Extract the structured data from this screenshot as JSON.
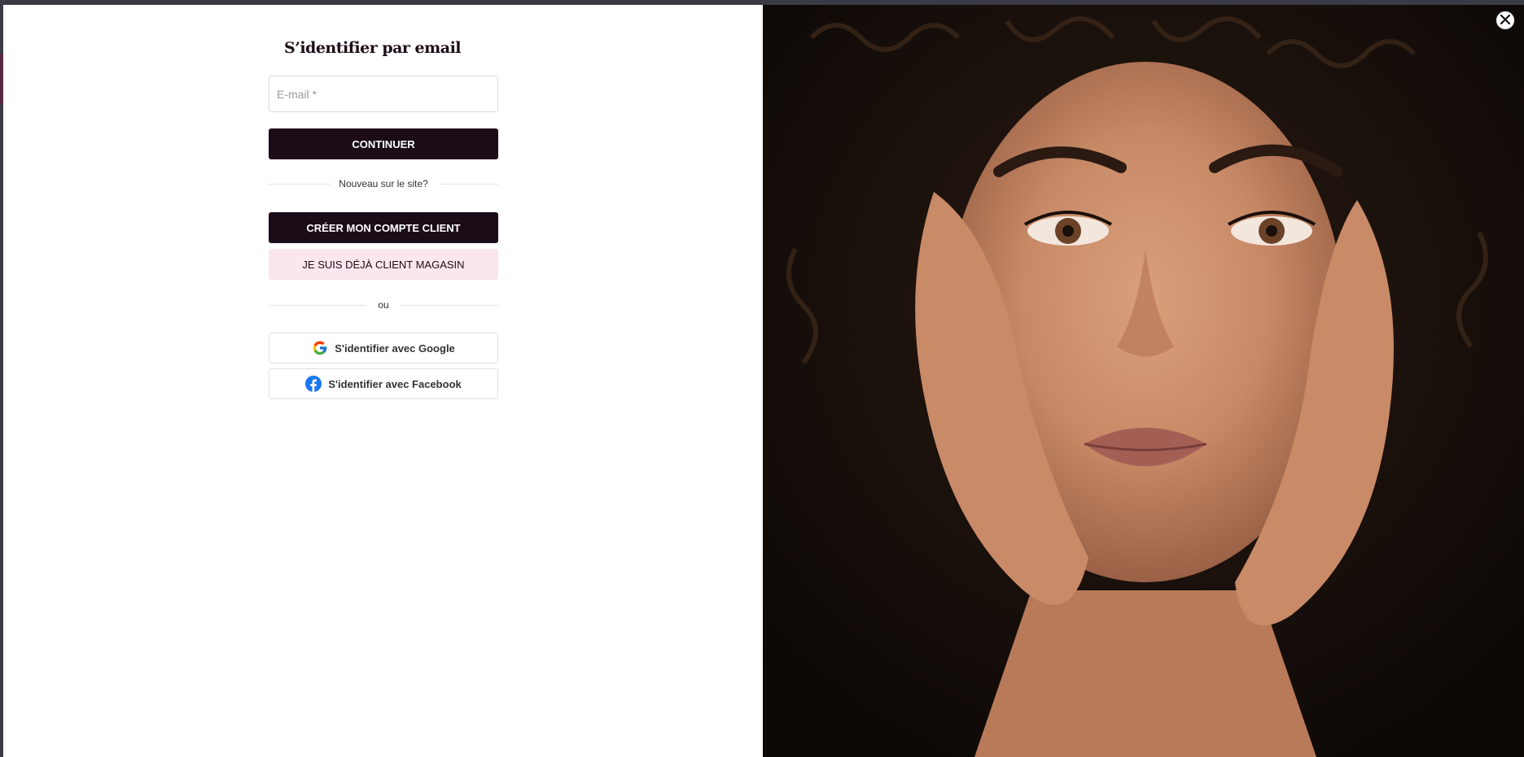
{
  "login": {
    "title": "S’identifier par email",
    "email_placeholder": "E-mail *",
    "email_value": "",
    "continue_label": "CONTINUER",
    "new_on_site": "Nouveau sur le site?",
    "create_account_label": "CRÉER MON COMPTE CLIENT",
    "store_client_label": "JE SUIS DÉJÀ CLIENT MAGASIN",
    "or_label": "ou",
    "google_label": "S'identifier avec Google",
    "facebook_label": "S'identifier avec Facebook"
  },
  "icons": {
    "close": "close-icon",
    "google": "google-icon",
    "facebook": "facebook-icon"
  },
  "colors": {
    "primary": "#1c0c18",
    "pink": "#fae6ec",
    "facebook": "#1877f2"
  }
}
